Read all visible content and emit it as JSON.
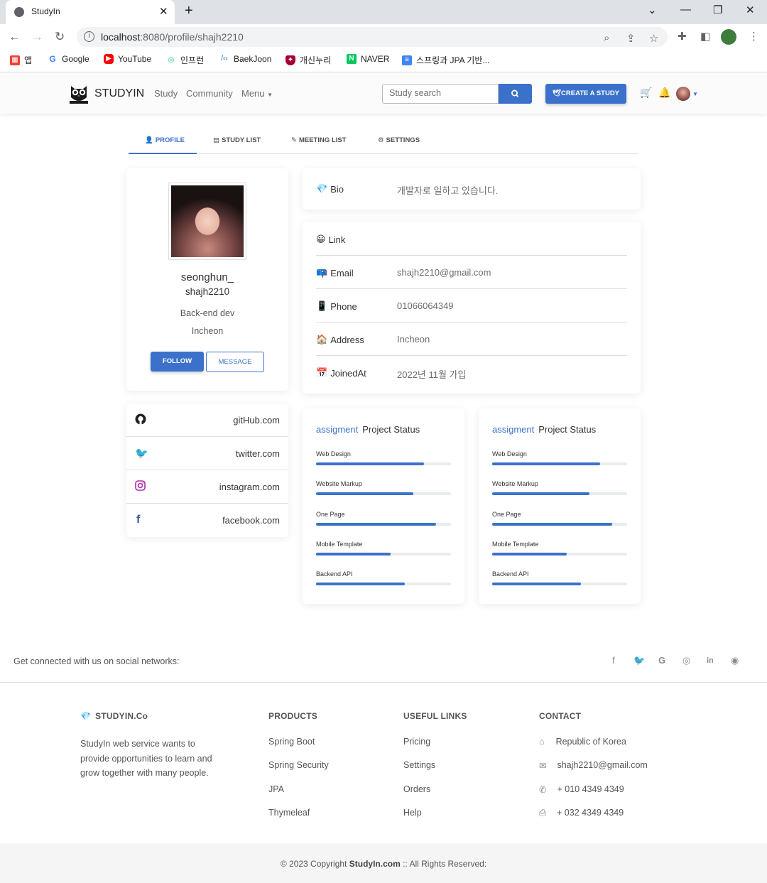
{
  "browser": {
    "tab_title": "StudyIn",
    "url_host": "localhost",
    "url_path": ":8080/profile/shajh2210",
    "bookmarks": [
      "앱",
      "Google",
      "YouTube",
      "인프런",
      "BaekJoon",
      "개신누리",
      "NAVER",
      "스프링과 JPA 기반..."
    ]
  },
  "nav": {
    "brand": "STUDYIN",
    "links": [
      "Study",
      "Community",
      "Menu"
    ],
    "search_placeholder": "Study search",
    "create_label": "CREATE A STUDY"
  },
  "tabs": [
    "PROFILE",
    "STUDY LIST",
    "MEETING LIST",
    "SETTINGS"
  ],
  "profile": {
    "nickname": "seonghun_",
    "username": "shajh2210",
    "occupation": "Back-end dev",
    "location": "Incheon",
    "follow_label": "FOLLOW",
    "message_label": "MESSAGE"
  },
  "socials": [
    {
      "icon": "github-icon",
      "label": "gitHub.com"
    },
    {
      "icon": "twitter-icon",
      "label": "twitter.com"
    },
    {
      "icon": "instagram-icon",
      "label": "instagram.com"
    },
    {
      "icon": "facebook-icon",
      "label": "facebook.com"
    }
  ],
  "bio": {
    "label": "Bio",
    "value": "개발자로 일하고 있습니다."
  },
  "info": [
    {
      "label": "Link",
      "value": ""
    },
    {
      "label": "Email",
      "value": "shajh2210@gmail.com"
    },
    {
      "label": "Phone",
      "value": "01066064349"
    },
    {
      "label": "Address",
      "value": "Incheon"
    },
    {
      "label": "JoinedAt",
      "value": "2022년 11월 가입"
    }
  ],
  "status_cards": [
    {
      "accent": "assigment",
      "title": "Project Status",
      "items": [
        {
          "label": "Web Design",
          "pct": 80
        },
        {
          "label": "Website Markup",
          "pct": 72
        },
        {
          "label": "One Page",
          "pct": 89
        },
        {
          "label": "Mobile Template",
          "pct": 55
        },
        {
          "label": "Backend API",
          "pct": 66
        }
      ]
    },
    {
      "accent": "assigment",
      "title": "Project Status",
      "items": [
        {
          "label": "Web Design",
          "pct": 80
        },
        {
          "label": "Website Markup",
          "pct": 72
        },
        {
          "label": "One Page",
          "pct": 89
        },
        {
          "label": "Mobile Template",
          "pct": 55
        },
        {
          "label": "Backend API",
          "pct": 66
        }
      ]
    }
  ],
  "footer": {
    "social_text": "Get connected with us on social networks:",
    "company": {
      "title": "STUDYIN.Co",
      "text": [
        "StudyIn web service wants to",
        "provide opportunities to learn and",
        "grow together with many people."
      ]
    },
    "products": {
      "title": "PRODUCTS",
      "items": [
        "Spring Boot",
        "Spring Security",
        "JPA",
        "Thymeleaf"
      ]
    },
    "useful": {
      "title": "USEFUL LINKS",
      "items": [
        "Pricing",
        "Settings",
        "Orders",
        "Help"
      ]
    },
    "contact": {
      "title": "CONTACT",
      "items": [
        "Republic of Korea",
        "shajh2210@gmail.com",
        "+ 010 4349 4349",
        "+ 032 4349 4349"
      ]
    },
    "copyright_pre": "© 2023 Copyright ",
    "copyright_brand": "StudyIn.com",
    "copyright_post": " :: All Rights Reserved:"
  },
  "colors": {
    "primary": "#3b71ca"
  }
}
